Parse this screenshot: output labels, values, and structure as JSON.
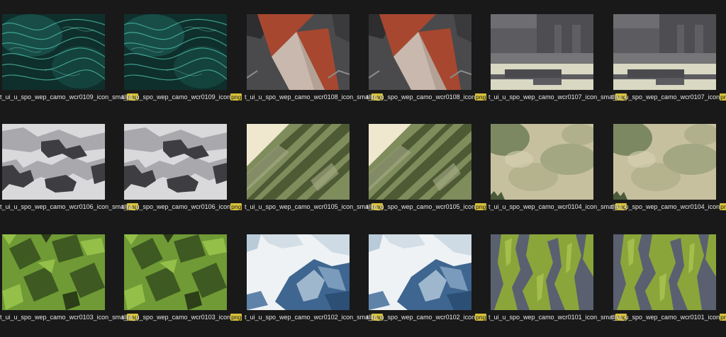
{
  "files": [
    {
      "base": "t_ui_u_spo_wep_camo_wcr0109_icon_small",
      "ext": "png",
      "icon": "teal-waves-thumbnail"
    },
    {
      "base": "t_ui_u_spo_wep_camo_wcr0109_icon",
      "ext": "png",
      "icon": "teal-waves-thumbnail"
    },
    {
      "base": "t_ui_u_spo_wep_camo_wcr0108_icon_small",
      "ext": "png",
      "icon": "red-gray-geometric-thumbnail"
    },
    {
      "base": "t_ui_u_spo_wep_camo_wcr0108_icon",
      "ext": "png",
      "icon": "red-gray-geometric-thumbnail"
    },
    {
      "base": "t_ui_u_spo_wep_camo_wcr0107_icon_small",
      "ext": "png",
      "icon": "gray-urban-blocks-thumbnail"
    },
    {
      "base": "t_ui_u_spo_wep_camo_wcr0107_icon",
      "ext": "png",
      "icon": "gray-urban-blocks-thumbnail"
    },
    {
      "base": "t_ui_u_spo_wep_camo_wcr0106_icon_small",
      "ext": "png",
      "icon": "gray-digital-camo-thumbnail"
    },
    {
      "base": "t_ui_u_spo_wep_camo_wcr0106_icon",
      "ext": "png",
      "icon": "gray-digital-camo-thumbnail"
    },
    {
      "base": "t_ui_u_spo_wep_camo_wcr0105_icon_small",
      "ext": "png",
      "icon": "olive-diagonal-stripes-thumbnail"
    },
    {
      "base": "t_ui_u_spo_wep_camo_wcr0105_icon",
      "ext": "png",
      "icon": "olive-diagonal-stripes-thumbnail"
    },
    {
      "base": "t_ui_u_spo_wep_camo_wcr0104_icon_small",
      "ext": "png",
      "icon": "tan-green-watercolor-thumbnail"
    },
    {
      "base": "t_ui_u_spo_wep_camo_wcr0104_icon",
      "ext": "png",
      "icon": "tan-green-watercolor-thumbnail"
    },
    {
      "base": "t_ui_u_spo_wep_camo_wcr0103_icon_small",
      "ext": "png",
      "icon": "green-squares-camo-thumbnail"
    },
    {
      "base": "t_ui_u_spo_wep_camo_wcr0103_icon",
      "ext": "png",
      "icon": "green-squares-camo-thumbnail"
    },
    {
      "base": "t_ui_u_spo_wep_camo_wcr0102_icon_small",
      "ext": "png",
      "icon": "blue-white-snow-camo-thumbnail"
    },
    {
      "base": "t_ui_u_spo_wep_camo_wcr0102_icon",
      "ext": "png",
      "icon": "blue-white-snow-camo-thumbnail"
    },
    {
      "base": "t_ui_u_spo_wep_camo_wcr0101_icon_small",
      "ext": "png",
      "icon": "lime-gray-tiger-camo-thumbnail"
    },
    {
      "base": "t_ui_u_spo_wep_camo_wcr0101_icon",
      "ext": "png",
      "icon": "lime-gray-tiger-camo-thumbnail"
    }
  ],
  "colors": {
    "background": "#191919",
    "filename_text": "#e8e8e8",
    "extension_highlight": "#d8c23a"
  }
}
